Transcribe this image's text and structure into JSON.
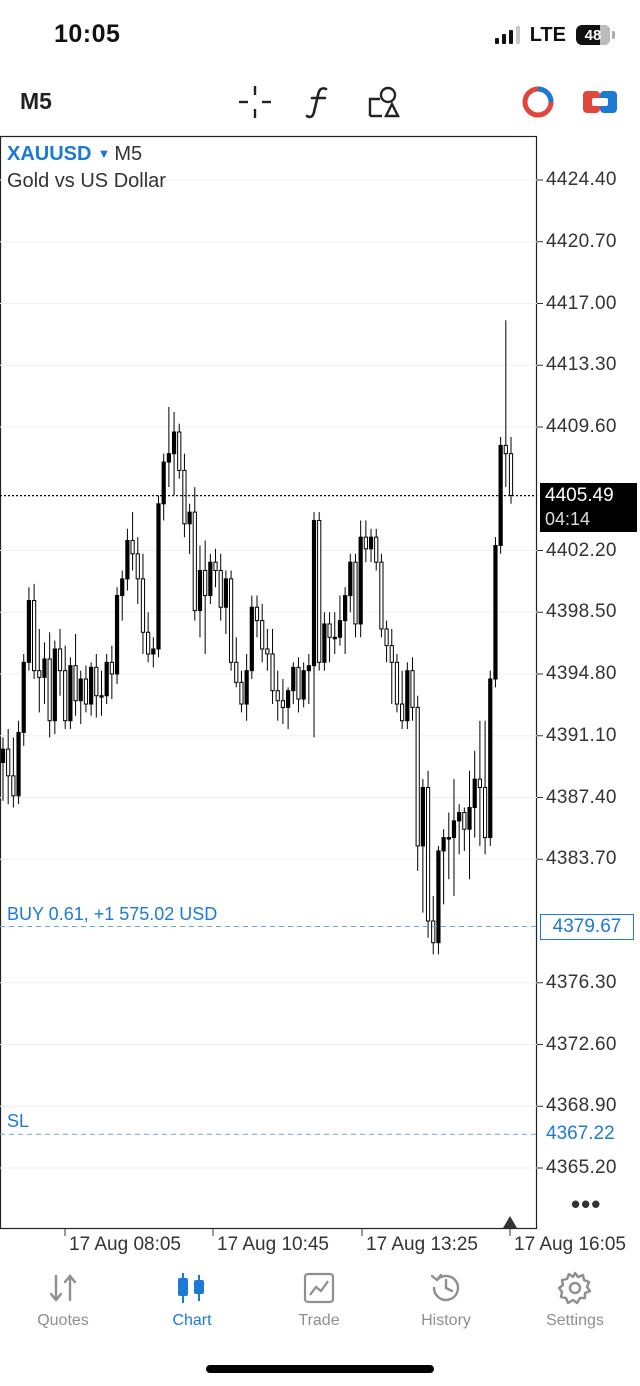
{
  "status": {
    "time": "10:05",
    "network": "LTE",
    "battery": "48"
  },
  "toolbar": {
    "timeframe": "M5",
    "icons": [
      "crosshair-icon",
      "function-icon",
      "objects-icon",
      "indicator-icon",
      "trade-toggle-icon"
    ],
    "colors": {
      "indicator": "#e0463b",
      "accent": "#1c7ad6"
    }
  },
  "chart": {
    "symbol": "XAUUSD",
    "symbol_arrow": "▼",
    "symbol_timeframe": "M5",
    "description": "Gold vs US Dollar",
    "current_price": "4405.49",
    "bar_timer": "04:14",
    "buy_label": "BUY 0.61, +1 575.02 USD",
    "buy_price": "4379.67",
    "sl_label": "SL",
    "sl_price": "4367.22",
    "more": "•••"
  },
  "chart_data": {
    "type": "candlestick",
    "symbol": "XAUUSD",
    "timeframe": "M5",
    "y_tick_labels": [
      "4424.40",
      "4420.70",
      "4417.00",
      "4413.30",
      "4409.60",
      "4402.20",
      "4398.50",
      "4394.80",
      "4391.10",
      "4387.40",
      "4383.70",
      "4376.30",
      "4372.60",
      "4368.90",
      "4365.20"
    ],
    "y_range": [
      4362.0,
      4426.0
    ],
    "x_tick_labels": [
      "17 Aug 08:05",
      "17 Aug 10:45",
      "17 Aug 13:25",
      "17 Aug 16:05"
    ],
    "bid_line": 4405.49,
    "buy_level": 4379.67,
    "sl_level": 4367.22,
    "candles": [
      [
        4389.5,
        4391.0,
        4387.2,
        4390.3
      ],
      [
        4390.3,
        4391.5,
        4387.0,
        4388.7
      ],
      [
        4388.7,
        4391.0,
        4386.8,
        4387.5
      ],
      [
        4387.5,
        4392.0,
        4387.0,
        4391.3
      ],
      [
        4391.3,
        4396.0,
        4390.5,
        4395.5
      ],
      [
        4395.5,
        4400.0,
        4395.0,
        4399.2
      ],
      [
        4399.2,
        4400.2,
        4394.5,
        4395.0
      ],
      [
        4395.0,
        4397.5,
        4392.5,
        4394.6
      ],
      [
        4394.6,
        4396.7,
        4393.0,
        4395.7
      ],
      [
        4395.7,
        4397.3,
        4391.0,
        4392.0
      ],
      [
        4392.0,
        4396.8,
        4391.2,
        4396.3
      ],
      [
        4396.3,
        4397.5,
        4393.5,
        4395.0
      ],
      [
        4395.0,
        4396.5,
        4391.5,
        4392.0
      ],
      [
        4392.0,
        4395.8,
        4391.5,
        4395.3
      ],
      [
        4395.3,
        4397.2,
        4392.3,
        4393.2
      ],
      [
        4393.2,
        4395.0,
        4391.8,
        4394.5
      ],
      [
        4394.5,
        4395.3,
        4392.5,
        4393.0
      ],
      [
        4393.0,
        4395.5,
        4392.3,
        4395.2
      ],
      [
        4395.2,
        4396.0,
        4392.2,
        4393.5
      ],
      [
        4393.5,
        4395.0,
        4392.3,
        4393.5
      ],
      [
        4393.5,
        4396.0,
        4393.0,
        4395.5
      ],
      [
        4395.5,
        4396.5,
        4393.3,
        4394.8
      ],
      [
        4394.8,
        4400.0,
        4394.2,
        4399.5
      ],
      [
        4399.5,
        4401.0,
        4398.0,
        4400.5
      ],
      [
        4400.5,
        4403.5,
        4399.8,
        4402.8
      ],
      [
        4402.8,
        4404.5,
        4401.0,
        4402.0
      ],
      [
        4402.0,
        4403.0,
        4399.0,
        4400.5
      ],
      [
        4400.5,
        4402.0,
        4396.0,
        4397.3
      ],
      [
        4397.3,
        4398.5,
        4395.5,
        4396.0
      ],
      [
        4396.0,
        4397.0,
        4395.2,
        4396.3
      ],
      [
        4396.3,
        4405.5,
        4395.8,
        4405.0
      ],
      [
        4405.0,
        4408.0,
        4404.0,
        4407.5
      ],
      [
        4407.5,
        4410.8,
        4406.0,
        4408.0
      ],
      [
        4408.0,
        4410.5,
        4405.5,
        4409.3
      ],
      [
        4409.3,
        4409.8,
        4406.5,
        4407.0
      ],
      [
        4407.0,
        4408.0,
        4403.0,
        4403.8
      ],
      [
        4403.8,
        4405.0,
        4402.0,
        4404.5
      ],
      [
        4404.5,
        4406.0,
        4398.0,
        4398.6
      ],
      [
        4398.6,
        4402.5,
        4397.0,
        4401.0
      ],
      [
        4401.0,
        4402.8,
        4396.0,
        4399.5
      ],
      [
        4399.5,
        4402.0,
        4399.0,
        4401.5
      ],
      [
        4401.5,
        4402.3,
        4400.0,
        4401.0
      ],
      [
        4401.0,
        4402.0,
        4398.0,
        4398.8
      ],
      [
        4398.8,
        4401.0,
        4397.2,
        4400.5
      ],
      [
        4400.5,
        4401.0,
        4395.0,
        4395.5
      ],
      [
        4395.5,
        4397.0,
        4394.0,
        4394.3
      ],
      [
        4394.3,
        4395.0,
        4392.5,
        4393.0
      ],
      [
        4393.0,
        4396.0,
        4392.0,
        4395.0
      ],
      [
        4395.0,
        4399.5,
        4394.5,
        4398.8
      ],
      [
        4398.8,
        4399.5,
        4397.0,
        4398.0
      ],
      [
        4398.0,
        4399.0,
        4395.5,
        4396.3
      ],
      [
        4396.3,
        4397.5,
        4395.0,
        4396.0
      ],
      [
        4396.0,
        4397.5,
        4393.0,
        4393.8
      ],
      [
        4393.8,
        4395.0,
        4392.0,
        4393.2
      ],
      [
        4393.2,
        4394.5,
        4391.8,
        4392.8
      ],
      [
        4392.8,
        4394.0,
        4391.5,
        4393.8
      ],
      [
        4393.8,
        4395.5,
        4393.0,
        4395.2
      ],
      [
        4395.2,
        4395.8,
        4392.5,
        4393.3
      ],
      [
        4393.3,
        4395.5,
        4392.8,
        4395.0
      ],
      [
        4395.0,
        4396.0,
        4393.0,
        4395.3
      ],
      [
        4395.3,
        4404.5,
        4391.0,
        4404.0
      ],
      [
        4404.0,
        4404.5,
        4395.0,
        4395.5
      ],
      [
        4395.5,
        4398.5,
        4395.0,
        4397.8
      ],
      [
        4397.8,
        4398.5,
        4395.5,
        4397.0
      ],
      [
        4397.0,
        4398.5,
        4396.0,
        4397.0
      ],
      [
        4397.0,
        4399.5,
        4396.5,
        4398.0
      ],
      [
        4398.0,
        4400.0,
        4396.0,
        4399.5
      ],
      [
        4399.5,
        4402.0,
        4398.5,
        4401.5
      ],
      [
        4401.5,
        4402.0,
        4397.0,
        4397.8
      ],
      [
        4397.8,
        4404.0,
        4397.0,
        4403.0
      ],
      [
        4403.0,
        4404.0,
        4401.5,
        4402.3
      ],
      [
        4402.3,
        4403.5,
        4401.5,
        4403.0
      ],
      [
        4403.0,
        4403.5,
        4401.0,
        4401.5
      ],
      [
        4401.5,
        4402.0,
        4397.0,
        4397.5
      ],
      [
        4397.5,
        4398.0,
        4395.5,
        4396.5
      ],
      [
        4396.5,
        4397.5,
        4393.0,
        4395.5
      ],
      [
        4395.5,
        4396.0,
        4392.5,
        4393.0
      ],
      [
        4393.0,
        4395.0,
        4391.5,
        4392.0
      ],
      [
        4392.0,
        4395.5,
        4391.5,
        4395.0
      ],
      [
        4395.0,
        4395.8,
        4392.0,
        4392.8
      ],
      [
        4392.8,
        4393.5,
        4383.0,
        4384.5
      ],
      [
        4384.5,
        4388.5,
        4380.5,
        4388.0
      ],
      [
        4388.0,
        4389.0,
        4379.0,
        4380.0
      ],
      [
        4380.0,
        4381.5,
        4378.0,
        4378.7
      ],
      [
        4378.7,
        4384.5,
        4378.0,
        4384.2
      ],
      [
        4384.2,
        4385.5,
        4381.0,
        4385.0
      ],
      [
        4385.0,
        4386.5,
        4382.5,
        4385.0
      ],
      [
        4385.0,
        4388.5,
        4381.5,
        4386.0
      ],
      [
        4386.0,
        4387.0,
        4384.0,
        4386.5
      ],
      [
        4386.5,
        4386.8,
        4384.2,
        4385.5
      ],
      [
        4385.5,
        4389.0,
        4382.5,
        4386.8
      ],
      [
        4386.8,
        4390.2,
        4385.0,
        4388.5
      ],
      [
        4388.5,
        4392.0,
        4384.5,
        4388.0
      ],
      [
        4388.0,
        4392.0,
        4384.0,
        4385.0
      ],
      [
        4385.0,
        4395.0,
        4384.5,
        4394.5
      ],
      [
        4394.5,
        4403.0,
        4394.0,
        4402.5
      ],
      [
        4402.5,
        4409.0,
        4402.0,
        4408.5
      ],
      [
        4408.5,
        4416.0,
        4406.0,
        4408.0
      ],
      [
        4408.0,
        4409.0,
        4405.0,
        4405.5
      ]
    ]
  },
  "tabs": [
    {
      "label": "Quotes",
      "icon": "quotes-icon",
      "active": false
    },
    {
      "label": "Chart",
      "icon": "chart-icon",
      "active": true
    },
    {
      "label": "Trade",
      "icon": "trade-icon",
      "active": false
    },
    {
      "label": "History",
      "icon": "history-icon",
      "active": false
    },
    {
      "label": "Settings",
      "icon": "settings-icon",
      "active": false
    }
  ]
}
